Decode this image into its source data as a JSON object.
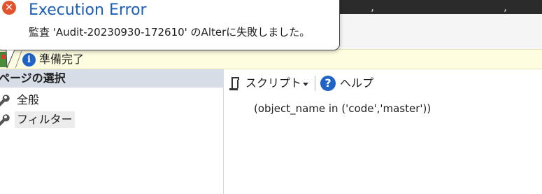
{
  "toast": {
    "title": "Execution Error",
    "message": "監査 'Audit-20230930-172610' のAlterに失敗しました。",
    "icon": "error-x-icon",
    "title_color": "#1b5fb7"
  },
  "status": {
    "text": "準備完了",
    "icon": "info-icon"
  },
  "pages_panel": {
    "header": "ページの選択",
    "items": [
      {
        "label": "全般",
        "icon": "wrench-icon",
        "selected": false
      },
      {
        "label": "フィルター",
        "icon": "wrench-icon",
        "selected": true
      }
    ]
  },
  "toolbar": {
    "script_label": "スクリプト",
    "help_label": "ヘルプ",
    "help_icon_glyph": "?",
    "info_icon_glyph": "i",
    "error_icon_glyph": "✕"
  },
  "content": {
    "filter_text": "(object_name in ('code','master'))"
  },
  "colors": {
    "status_bg": "#fffde0",
    "panel_header_bg": "#d7dde6",
    "accent_blue": "#1f63c6",
    "error_red": "#e2532d"
  }
}
